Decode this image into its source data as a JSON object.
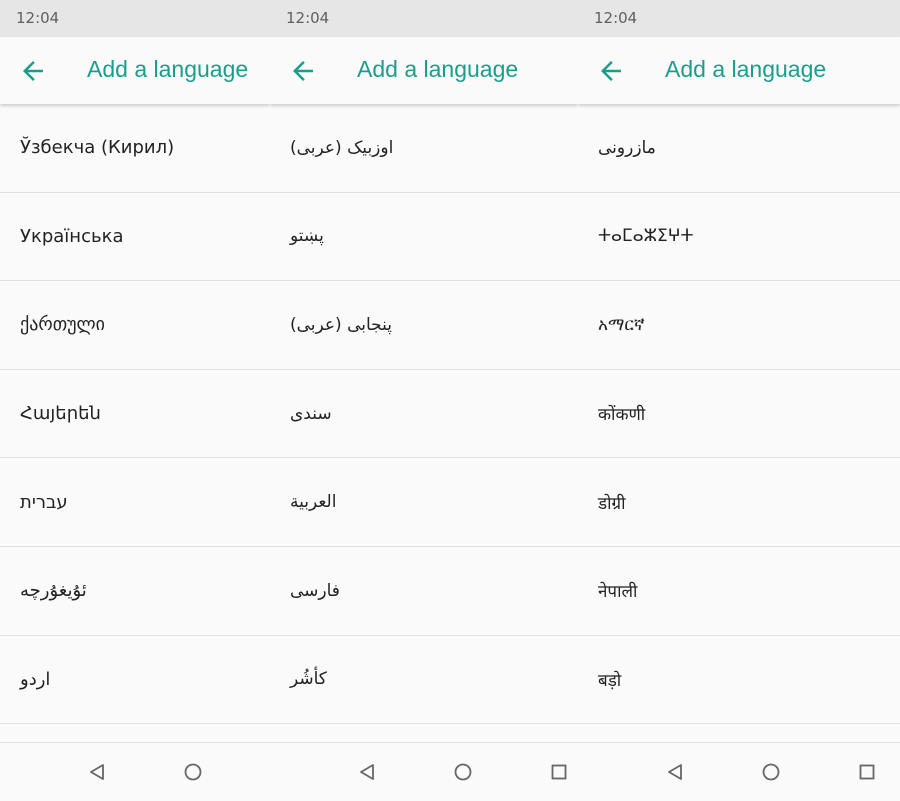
{
  "colors": {
    "accent": "#1a9e8c",
    "status_bar": "#e6e6e6",
    "background": "#fafafa",
    "divider": "#e0e0e0",
    "text": "#222222"
  },
  "panels": [
    {
      "status_time": "12:04",
      "back_icon": "arrow-left-icon",
      "title": "Add a language",
      "languages": [
        "Ўзбекча (Кирил)",
        "Українська",
        "ქართული",
        "Հայերեն",
        "עברית",
        "ئۇيغۇرچە",
        "اردو"
      ],
      "nav_icons": [
        "back-triangle-icon",
        "home-circle-icon"
      ]
    },
    {
      "status_time": "12:04",
      "back_icon": "arrow-left-icon",
      "title": "Add a language",
      "languages": [
        "اوزبیک (عربی)",
        "پښتو",
        "پنجابی (عربی)",
        "سندی",
        "العربية",
        "فارسی",
        "کأشُر"
      ],
      "nav_icons": [
        "back-triangle-icon",
        "home-circle-icon",
        "recents-square-icon"
      ]
    },
    {
      "status_time": "12:04",
      "back_icon": "arrow-left-icon",
      "title": "Add a language",
      "languages": [
        "مازرونی",
        "ⵜⴰⵎⴰⵣⵉⵖⵜ",
        "አማርኛ",
        "कोंकणी",
        "डोग्री",
        "नेपाली",
        "बड़ो"
      ],
      "nav_icons": [
        "back-triangle-icon",
        "home-circle-icon",
        "recents-square-icon"
      ]
    }
  ]
}
